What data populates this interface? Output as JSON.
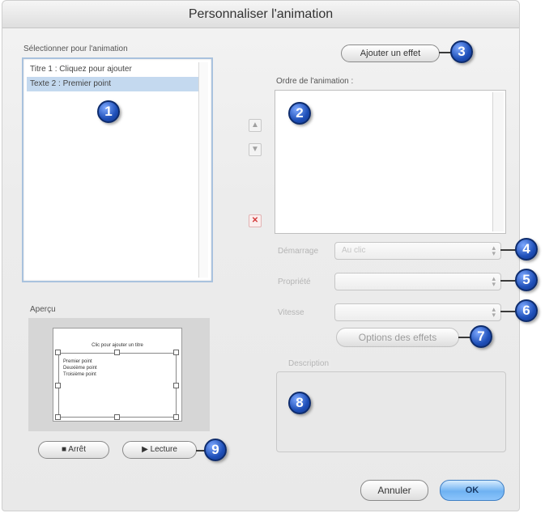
{
  "window": {
    "title": "Personnaliser l'animation"
  },
  "select_section": {
    "label": "Sélectionner pour l'animation",
    "items": [
      {
        "label": "Titre 1 : Cliquez pour ajouter",
        "selected": false
      },
      {
        "label": "Texte 2 : Premier point",
        "selected": true
      }
    ]
  },
  "preview": {
    "label": "Aperçu",
    "slide_title": "Clic pour ajouter un titre",
    "slide_bullets": [
      "Premier point",
      "Deuxième point",
      "Troisième point"
    ]
  },
  "buttons": {
    "add_effect": "Ajouter un effet",
    "effect_options": "Options des effets",
    "stop": "Arrêt",
    "play": "Lecture",
    "cancel": "Annuler",
    "ok": "OK"
  },
  "order": {
    "label": "Ordre de l'animation :"
  },
  "fields": {
    "start_label": "Démarrage",
    "start_value": "Au clic",
    "property_label": "Propriété",
    "property_value": "",
    "speed_label": "Vitesse",
    "speed_value": ""
  },
  "description": {
    "label": "Description"
  },
  "callouts": [
    "1",
    "2",
    "3",
    "4",
    "5",
    "6",
    "7",
    "8",
    "9"
  ],
  "icons": {
    "move_up": "arrow-up-icon",
    "move_down": "arrow-down-icon",
    "delete": "delete-x-icon",
    "stop": "square-stop-icon",
    "play": "triangle-play-icon",
    "select": "up-down-chevron-icon"
  },
  "colors": {
    "selection": "#c4d9ef",
    "callout": "#1e4fb8",
    "default_button": "#6fb2f2",
    "delete_icon": "#d43a3a"
  }
}
